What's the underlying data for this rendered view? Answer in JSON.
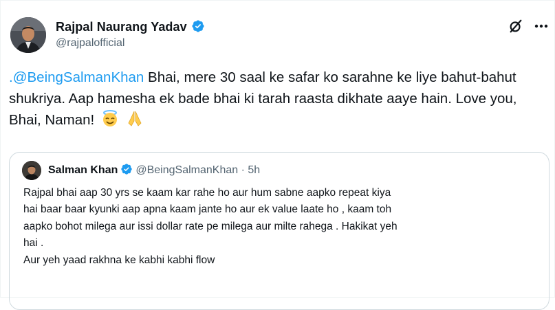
{
  "tweet": {
    "author": {
      "name": "Rajpal Naurang Yadav",
      "handle": "@rajpalofficial",
      "avatar_icon": "profile-photo"
    },
    "text_mention": ".@BeingSalmanKhan",
    "text_body": " Bhai, mere 30 saal ke safar ko sarahne ke liye bahut-bahut shukriya. Aap hamesha ek bade bhai ki tarah raasta dikhate aaye hain. Love you, Bhai, Naman!",
    "emojis": [
      "smiling-face-with-halo",
      "folded-hands"
    ],
    "actions": {
      "grok_icon": "grok-slash-icon",
      "more_icon": "more-horizontal-icon"
    }
  },
  "quote": {
    "author": {
      "name": "Salman Khan",
      "handle": "@BeingSalmanKhan",
      "separator": "·",
      "time": "5h"
    },
    "lines": [
      "Rajpal bhai aap 30 yrs se kaam kar rahe ho aur hum sabne aapko repeat kiya",
      "hai baar baar kyunki aap apna kaam jante ho aur ek value laate ho , kaam toh",
      "aapko bohot milega aur issi dollar rate pe milega aur milte rahega . Hakikat yeh",
      "hai .",
      "Aur yeh yaad rakhna ke kabhi kabhi flow"
    ]
  },
  "colors": {
    "verified": "#1d9bf0",
    "mention": "#1d9bf0",
    "secondary_text": "#536471",
    "border": "#cfd9de"
  }
}
